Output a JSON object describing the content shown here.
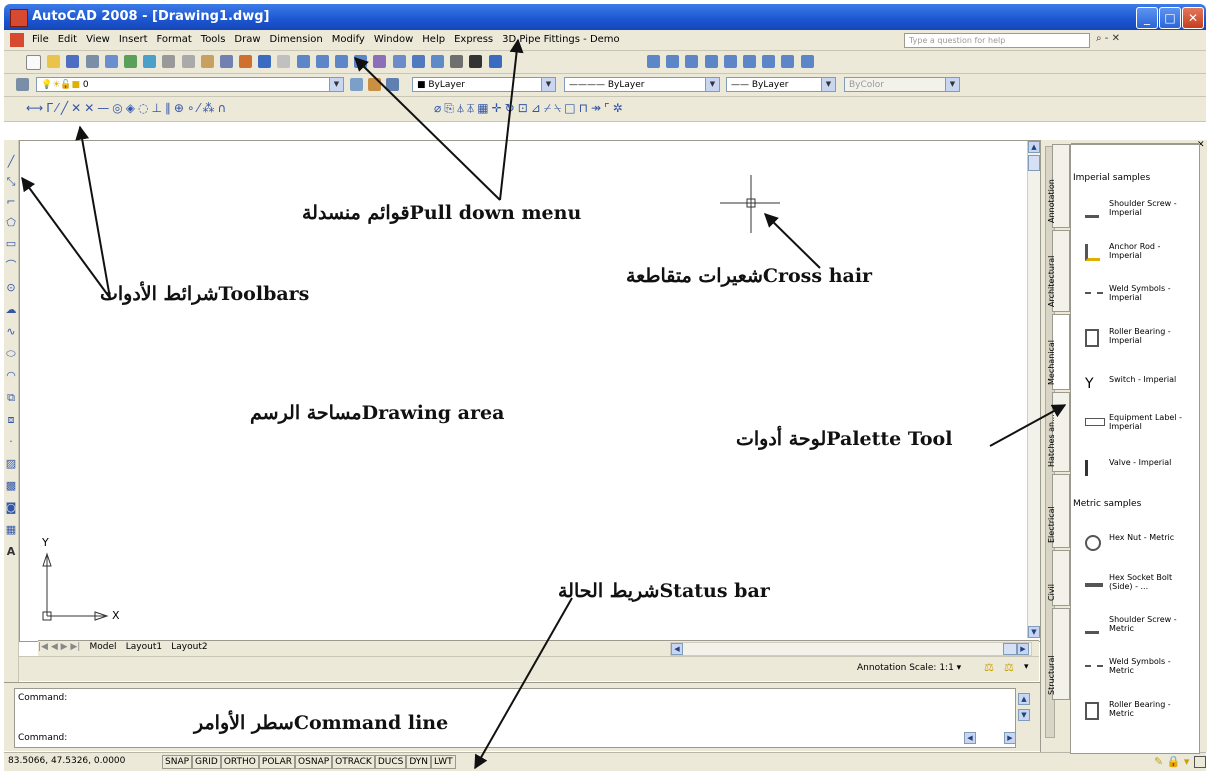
{
  "window": {
    "title": "AutoCAD 2008 - [Drawing1.dwg]",
    "minimize_glyph": "_",
    "maximize_glyph": "□",
    "close_glyph": "✕"
  },
  "menu": {
    "items": [
      "File",
      "Edit",
      "View",
      "Insert",
      "Format",
      "Tools",
      "Draw",
      "Dimension",
      "Modify",
      "Window",
      "Help",
      "Express",
      "3D Pipe Fittings - Demo"
    ],
    "help_placeholder": "Type a question for help",
    "right_controls": "- ✕"
  },
  "layers_toolbar": {
    "layer_value": "0",
    "color_value": "■ ByLayer",
    "linetype_value": "———— ByLayer",
    "lineweight_value": "—— ByLayer",
    "plotstyle_value": "ByColor"
  },
  "drawing_area": {
    "y_axis_label": "Y",
    "x_axis_label": "X",
    "tabs": [
      "Model",
      "Layout1",
      "Layout2"
    ],
    "annotation_scale_label": "Annotation Scale: 1:1 ▾"
  },
  "command_window": {
    "line1": "Command:",
    "line2": "Command:"
  },
  "status_bar": {
    "coordinates": "83.5066, 47.5326, 0.0000",
    "toggles": [
      "SNAP",
      "GRID",
      "ORTHO",
      "POLAR",
      "OSNAP",
      "OTRACK",
      "DUCS",
      "DYN",
      "LWT"
    ]
  },
  "palette": {
    "tabs": [
      "Annotation",
      "Architectural",
      "Mechanical",
      "Hatches an...",
      "Electrical",
      "Civil",
      "Structural"
    ],
    "active_tab": "Mechanical",
    "imperial_header": "Imperial samples",
    "imperial_items": [
      "Shoulder Screw - Imperial",
      "Anchor Rod - Imperial",
      "Weld Symbols - Imperial",
      "Roller Bearing - Imperial",
      "Switch - Imperial",
      "Equipment Label - Imperial",
      "Valve - Imperial"
    ],
    "metric_header": "Metric samples",
    "metric_items": [
      "Hex Nut - Metric",
      "Hex Socket Bolt (Side) - ...",
      "Shoulder Screw - Metric",
      "Weld Symbols - Metric",
      "Roller Bearing - Metric"
    ]
  },
  "annotations": {
    "pull_down_menu": "قوائم منسدلةPull down menu",
    "toolbars": "شرائط الأدواتToolbars",
    "cross_hair": "شعيرات متقاطعةCross hair",
    "drawing_area": "مساحة الرسمDrawing area",
    "palette_tool": "لوحة أدواتPalette Tool",
    "status_bar": "شريط الحالةStatus bar",
    "command_line": "سطر الأوامرCommand line"
  },
  "colors": {
    "titlebar": "#1c56d1",
    "chrome": "#ece9d8",
    "tool_blue": "#3456a8"
  }
}
